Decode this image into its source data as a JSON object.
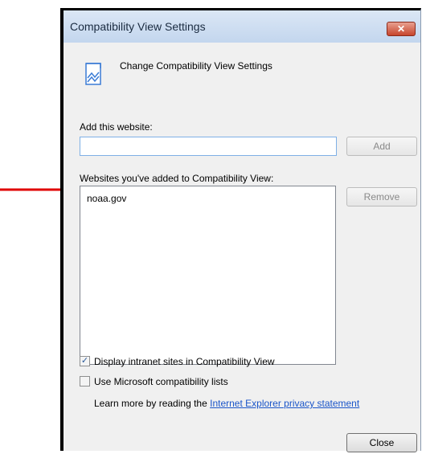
{
  "dialog": {
    "title": "Compatibility View Settings",
    "close_glyph": "✕",
    "header_text": "Change Compatibility View Settings",
    "add_label": "Add this website:",
    "add_value": "",
    "add_button": "Add",
    "list_label": "Websites you've added to Compatibility View:",
    "list_items": [
      "noaa.gov"
    ],
    "remove_button": "Remove",
    "checkbox_intranet": {
      "label": "Display intranet sites in Compatibility View",
      "checked": true
    },
    "checkbox_mslists": {
      "label": "Use Microsoft compatibility lists",
      "checked": false
    },
    "learn_more_prefix": "Learn more by reading the",
    "learn_more_link": "Internet Explorer privacy statement",
    "close_button": "Close"
  },
  "colors": {
    "arrow": "#e00000",
    "link": "#1a55c9",
    "title_bar": "#c3d6ee"
  },
  "icons": {
    "header": "compat-view-icon",
    "arrow": "annotation-arrow"
  }
}
